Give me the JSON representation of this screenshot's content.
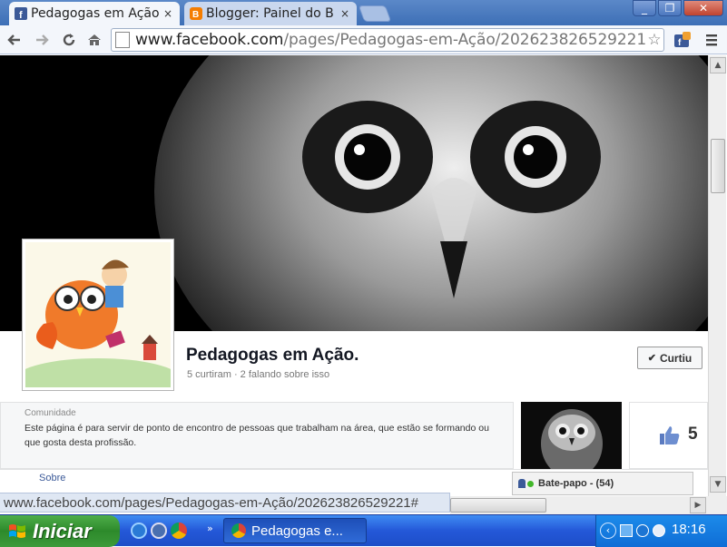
{
  "browser": {
    "tabs": [
      {
        "title": "Pedagogas em Ação",
        "active": true
      },
      {
        "title": "Blogger: Painel do B",
        "active": false
      }
    ],
    "close_glyph": "×",
    "window_buttons": [
      "_",
      "❐",
      "✕"
    ],
    "url_host": "www.facebook.com",
    "url_path": "/pages/Pedagogas-em-Ação/202623826529221"
  },
  "page": {
    "title": "Pedagogas em Ação.",
    "stats": "5 curtiram · 2 falando sobre isso",
    "liked_button": "Curtiu",
    "category": "Comunidade",
    "description": "Este página é para servir de ponto de encontro de pessoas que trabalham na área, que estão se formando ou que gosta desta profissão.",
    "likes_count": "5",
    "about_link": "Sobre",
    "chat_label": "Bate-papo - (54)"
  },
  "status_url": "www.facebook.com/pages/Pedagogas-em-Ação/202623826529221#",
  "taskbar": {
    "start_label": "Iniciar",
    "task_title": "Pedagogas e...",
    "clock": "18:16",
    "overflow": "»"
  },
  "colors": {
    "facebook_blue": "#3b5998",
    "xp_blue": "#245edb",
    "start_green": "#3d9a3a"
  },
  "icons": [
    "facebook-favicon",
    "blogger-favicon",
    "back-arrow-icon",
    "forward-arrow-icon",
    "reload-icon",
    "home-icon",
    "star-icon",
    "owl-image",
    "thumbs-up-icon",
    "windows-flag-icon",
    "ie-icon",
    "media-player-icon",
    "chrome-icon"
  ]
}
